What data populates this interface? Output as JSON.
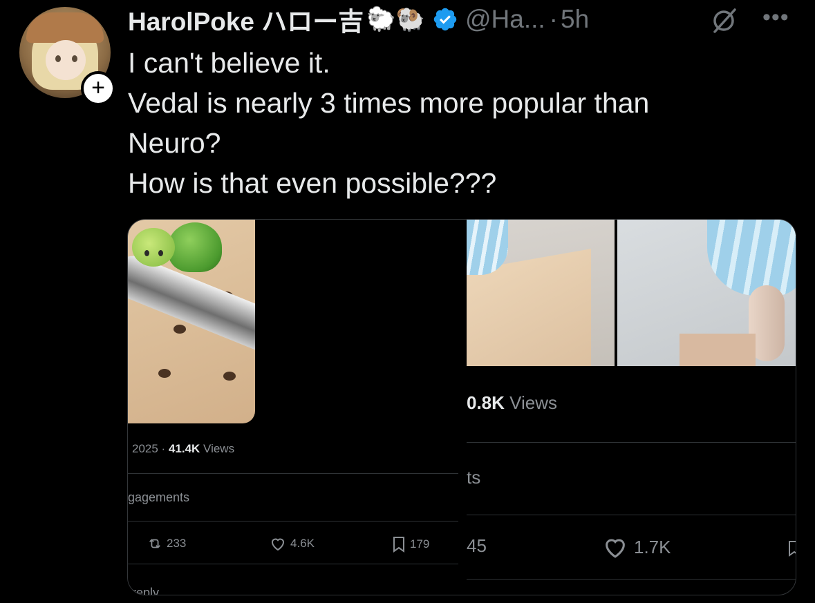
{
  "author": {
    "display_name": "HarolPoke ハロー吉",
    "emoji": "🐑🐏",
    "handle": "@Ha...",
    "time": "5h"
  },
  "tweet": {
    "lines": [
      "I can't believe it.",
      "Vedal is nearly 3 times more popular than",
      "Neuro?",
      "How is that even possible???"
    ]
  },
  "left_screenshot": {
    "date": "2025 · ",
    "views_count": "41.4K",
    "views_label": " Views",
    "engagements": "gagements",
    "retweets": "233",
    "likes": "4.6K",
    "bookmarks": "179",
    "reply_cut": "reply"
  },
  "right_screenshot": {
    "views_count": "0.8K",
    "views_label": " Views",
    "engagements": "ts",
    "retweets": "45",
    "likes": "1.7K"
  },
  "colors": {
    "background": "#000000",
    "text": "#e7e9ea",
    "muted": "#71767b",
    "verified": "#1d9bf0",
    "divider": "#2f3336"
  },
  "icons": [
    "follow-plus-icon",
    "verified-badge-icon",
    "grok-icon",
    "more-icon",
    "retweet-icon",
    "heart-icon",
    "bookmark-icon"
  ]
}
